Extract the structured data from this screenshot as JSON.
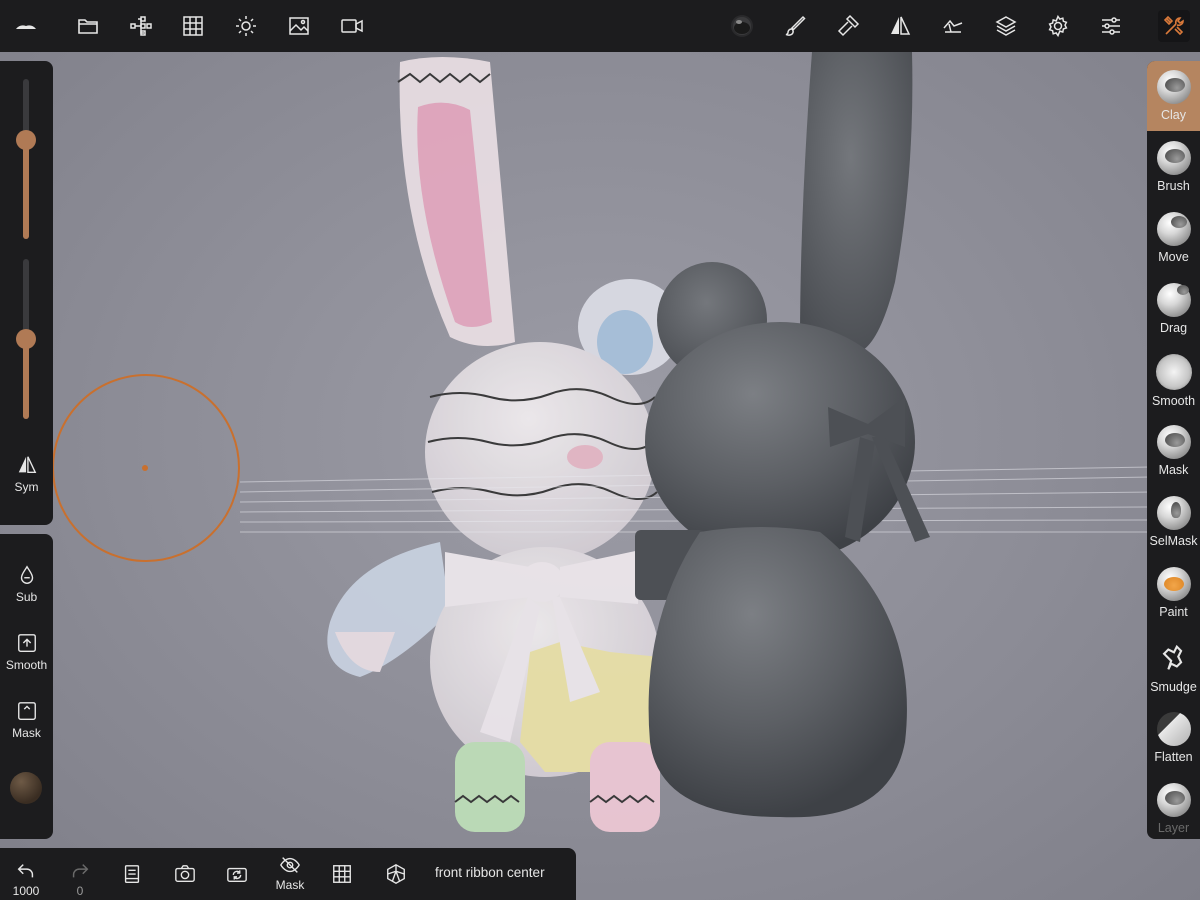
{
  "topbar": {
    "icons": [
      "cloud-logo-icon",
      "folder-icon",
      "scene-tree-icon",
      "topology-grid-icon",
      "light-sun-icon",
      "background-image-icon",
      "camera-icon",
      "material-sphere-icon",
      "paint-brush-icon",
      "hammer-icon",
      "symmetry-icon",
      "interaction-icon",
      "layers-icon",
      "settings-gear-icon",
      "sliders-icon",
      "tools-icon"
    ]
  },
  "left_panel": {
    "sym_label": "Sym",
    "sub_label": "Sub",
    "smooth_label": "Smooth",
    "mask_label": "Mask",
    "radius_slider": 0.62,
    "intensity_slider": 0.5
  },
  "tools": [
    {
      "label": "Clay",
      "active": true
    },
    {
      "label": "Brush",
      "active": false
    },
    {
      "label": "Move",
      "active": false
    },
    {
      "label": "Drag",
      "active": false
    },
    {
      "label": "Smooth",
      "active": false
    },
    {
      "label": "Mask",
      "active": false
    },
    {
      "label": "SelMask",
      "active": false
    },
    {
      "label": "Paint",
      "active": false
    },
    {
      "label": "Smudge",
      "active": false
    },
    {
      "label": "Flatten",
      "active": false
    },
    {
      "label": "Layer",
      "active": false
    }
  ],
  "bottombar": {
    "undo_count": "1000",
    "redo_count": "0",
    "mask_label": "Mask",
    "status_text": "front ribbon center"
  },
  "colors": {
    "accent": "#b58560",
    "brush_cursor": "#c9702e",
    "panel_bg": "#1c1c1e"
  }
}
